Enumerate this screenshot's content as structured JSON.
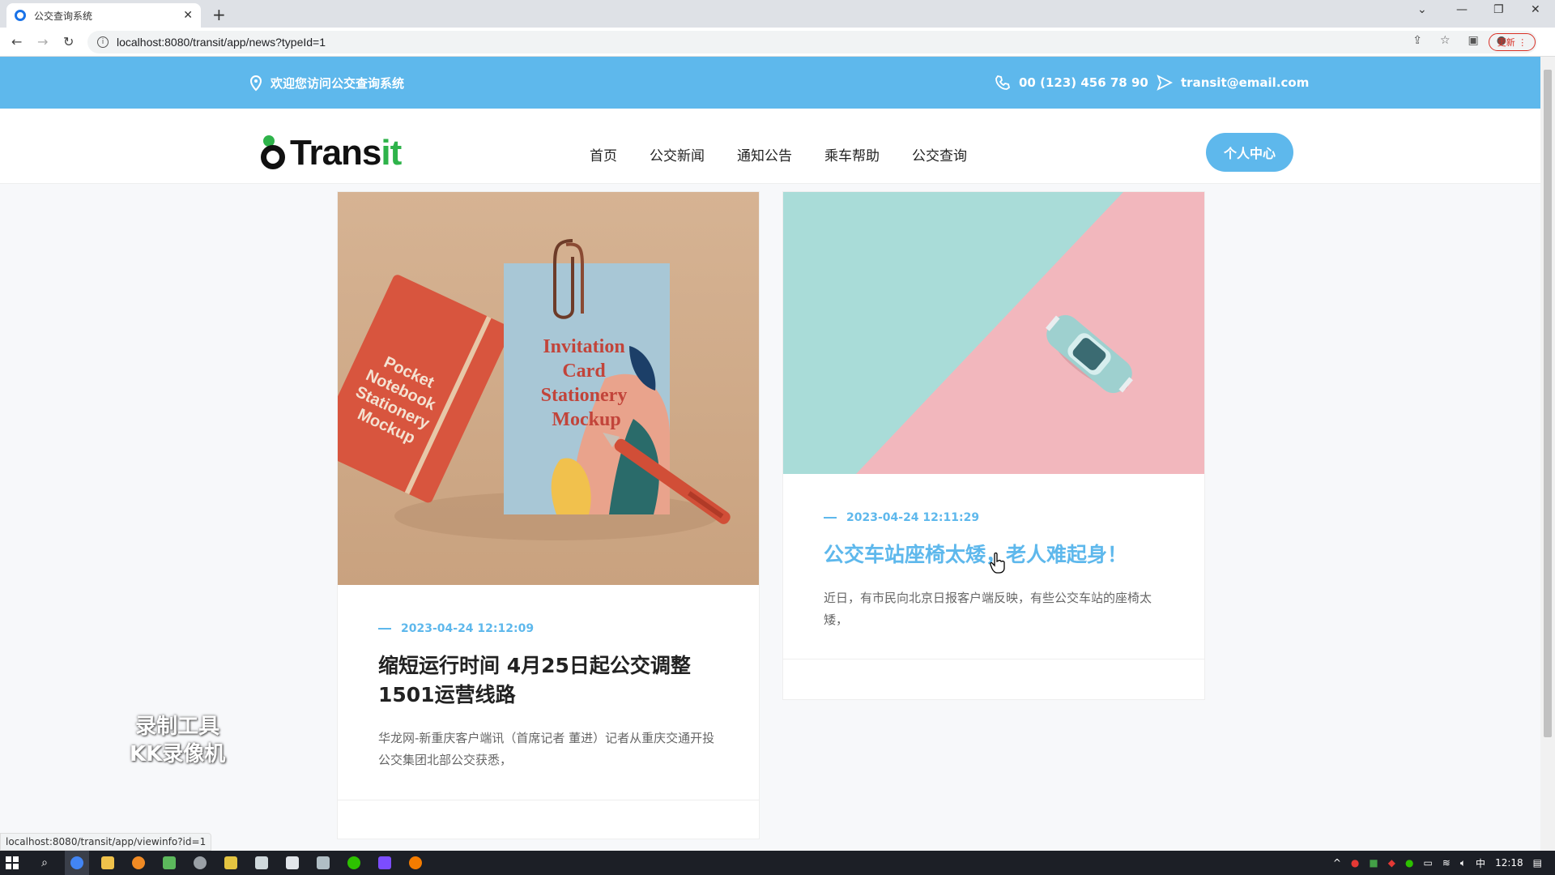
{
  "browser": {
    "tab_title": "公交查询系统",
    "url": "localhost:8080/transit/app/news?typeId=1",
    "update_label": "更新",
    "status_url": "localhost:8080/transit/app/viewinfo?id=1"
  },
  "topbar": {
    "welcome": "欢迎您访问公交查询系统",
    "phone": "00 (123) 456 78 90",
    "email": "transit@email.com"
  },
  "header": {
    "logo_dark": "Trans",
    "logo_green": "it",
    "nav": [
      "首页",
      "公交新闻",
      "通知公告",
      "乘车帮助",
      "公交查询"
    ],
    "user_center": "个人中心"
  },
  "cards": [
    {
      "image_text": "Invitation Card Stationery Mockup",
      "notebook_text": "Pocket Notebook Stationery Mockup",
      "date": "2023-04-24 12:12:09",
      "title": "缩短运行时间 4月25日起公交调整1501运营线路",
      "summary": "华龙网-新重庆客户端讯（首席记者 董进）记者从重庆交通开投公交集团北部公交获悉，"
    },
    {
      "date": "2023-04-24 12:11:29",
      "title": "公交车站座椅太矮，老人难起身！",
      "summary": "近日，有市民向北京日报客户端反映，有些公交车站的座椅太矮，"
    }
  ],
  "watermark": {
    "line1": "录制工具",
    "line2": "KK录像机"
  },
  "taskbar": {
    "time": "12:18",
    "ime": "中"
  },
  "colors": {
    "accent": "#5eb8ec",
    "logo_green": "#2eb34a"
  }
}
